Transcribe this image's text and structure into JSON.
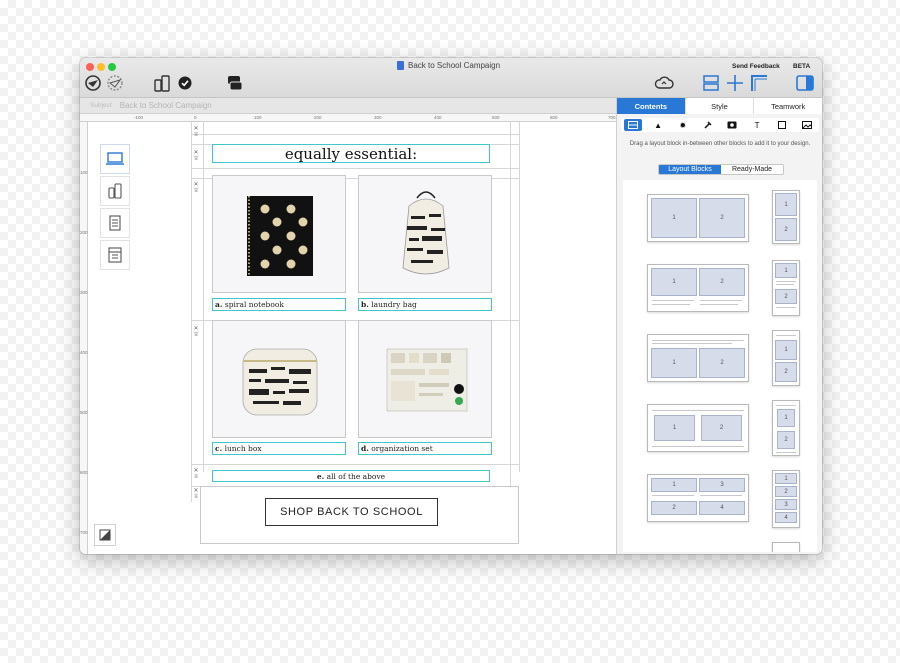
{
  "window": {
    "title": "Back to School Campaign",
    "send_feedback": "Send Feedback",
    "beta": "BETA"
  },
  "subject": {
    "label": "Subject",
    "value": "Back to School Campaign"
  },
  "ruler": {
    "top_ticks": [
      "-100",
      "0",
      "100",
      "200",
      "300",
      "400",
      "500",
      "600",
      "700"
    ],
    "left_ticks": [
      "100",
      "200",
      "300",
      "400",
      "500",
      "600",
      "700"
    ]
  },
  "canvas": {
    "heading": "equally essential:",
    "products": [
      {
        "letter": "a.",
        "name": "spiral notebook"
      },
      {
        "letter": "b.",
        "name": "laundry bag"
      },
      {
        "letter": "c.",
        "name": "lunch box"
      },
      {
        "letter": "d.",
        "name": "organization set"
      }
    ],
    "all_above": {
      "letter": "e.",
      "name": "all of the above"
    },
    "cta_label": "SHOP BACK TO SCHOOL"
  },
  "panel": {
    "tabs": [
      "Contents",
      "Style",
      "Teamwork"
    ],
    "active_tab": "Contents",
    "help_text": "Drag a layout block in-between other blocks to add it to your design.",
    "segments": [
      "Layout Blocks",
      "Ready-Made"
    ],
    "active_segment": "Layout Blocks",
    "block_labels": [
      "1",
      "2",
      "3",
      "4"
    ]
  },
  "colors": {
    "accent": "#2a78d6",
    "guide": "#3fc6cf"
  }
}
